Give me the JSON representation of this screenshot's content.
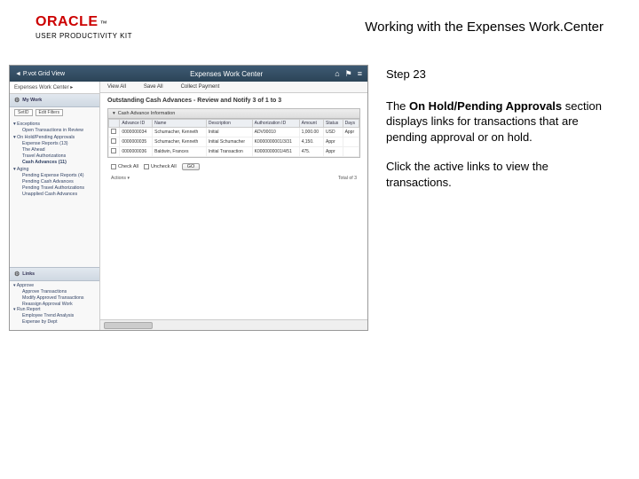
{
  "header": {
    "brand": "ORACLE",
    "tm": "™",
    "subbrand": "USER PRODUCTIVITY KIT",
    "doc_title": "Working with the Expenses Work.Center"
  },
  "screenshot": {
    "topbar": {
      "back_label": "◄  P.vot Grid View",
      "title": "Expenses Work Center",
      "icon_home": "⌂",
      "icon_flag": "⚑",
      "icon_menu": "≡"
    },
    "sidebar": {
      "wc_label": "Expenses Work Center ▸",
      "edit_btn": "Edit Filters",
      "mywork_label": "My Work",
      "scope_dd": "SetID",
      "groups": [
        {
          "label": "▾ Exceptions",
          "items": [
            "Open Transactions in Review"
          ]
        },
        {
          "label": "▾ On Hold/Pending Approvals",
          "items": [
            "Expense Reports (13)",
            "The Ahead",
            "Travel Authorizations",
            "Cash Advances (11)"
          ]
        },
        {
          "label": "▾ Aging",
          "items": [
            "Pending Expense Reports (4)",
            "Pending Cash Advances",
            "Pending Travel Authorizations",
            "Unapplied Cash Advances"
          ]
        }
      ],
      "links_label": "Links",
      "links": [
        {
          "label": "▾ Approve",
          "items": [
            "Approve Transactions",
            "Modify Approved Transactions",
            "Reassign Approval Work"
          ]
        },
        {
          "label": "▾ Run Report",
          "items": [
            "Employee Trend Analysis",
            "Expense by Dept"
          ]
        }
      ]
    },
    "main": {
      "tabs": [
        "View All",
        "Save All",
        "Collect Payment"
      ],
      "title": "Outstanding Cash Advances - Review and Notify   3 of 1 to 3",
      "box_label": "Cash Advance Information",
      "columns": [
        "",
        "Advance ID",
        "Name",
        "Description",
        "Authorization ID",
        "Amount",
        "Status",
        "Days"
      ],
      "rows": [
        [
          "",
          "0000000034",
          "Schumacher, Kenneth",
          "Initial",
          "ADV00010",
          "1,000.00",
          "USD",
          "Appr"
        ],
        [
          "",
          "0000000035",
          "Schumacher, Kenneth",
          "Initial Schumacher",
          "K0000000001/3/31",
          "4,150.",
          "Appr",
          ""
        ],
        [
          "",
          "0000000036",
          "Baldwin, Frances",
          "Initial Transaction",
          "K0000000001/4/51",
          "475.",
          "Appr",
          ""
        ]
      ],
      "chk_all": "Check All",
      "unchk_all": "Uncheck All",
      "go_btn": "GO",
      "action_dd": "Actions ▾",
      "pager_total": "Total of 3"
    }
  },
  "instructions": {
    "step_label": "Step 23",
    "para1a": "The ",
    "para1b": "On Hold/Pending Approvals",
    "para1c": " section displays links for transactions that are pending approval or on hold.",
    "para2": "Click the active links to view the transactions."
  }
}
